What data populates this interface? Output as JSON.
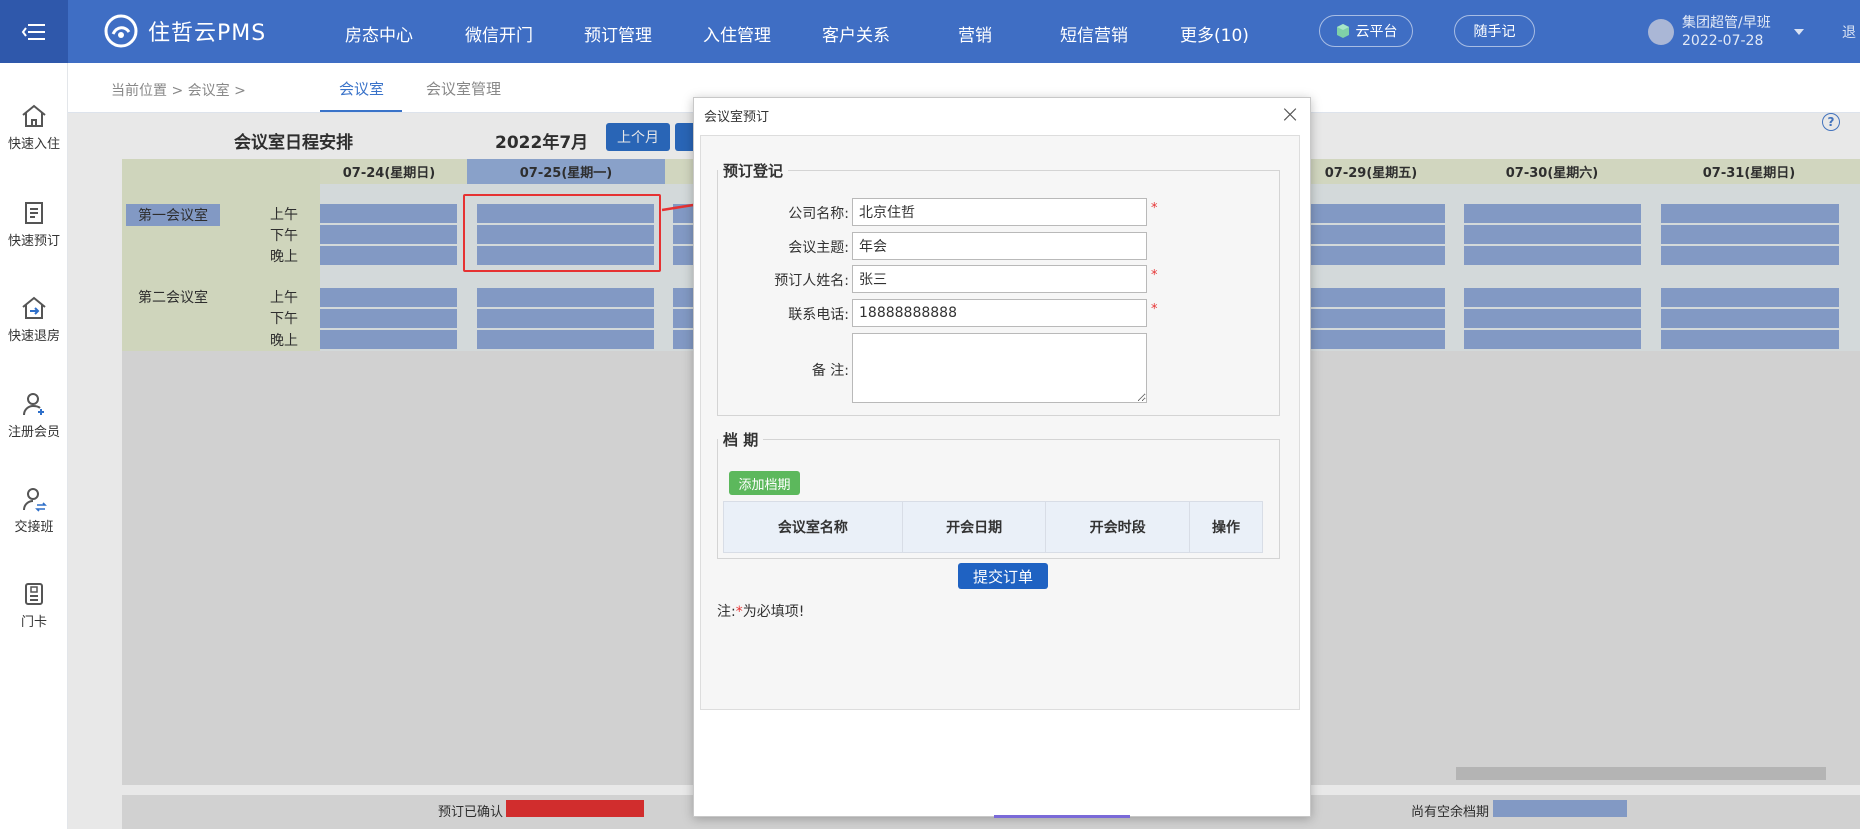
{
  "app": {
    "name": "住哲云PMS"
  },
  "nav": {
    "items": [
      "房态中心",
      "微信开门",
      "预订管理",
      "入住管理",
      "客户关系",
      "营销",
      "短信营销",
      "更多(10)"
    ]
  },
  "top_right": {
    "cloud": "云平台",
    "notes": "随手记",
    "user": "集团超管/早班",
    "date": "2022-07-28",
    "extra": "退"
  },
  "sidebar": {
    "items": [
      "快速入住",
      "快速预订",
      "快速退房",
      "注册会员",
      "交接班",
      "门卡"
    ]
  },
  "breadcrumb": "当前位置 > 会议室 >",
  "subtabs": [
    {
      "label": "会议室",
      "active": true
    },
    {
      "label": "会议室管理",
      "active": false
    }
  ],
  "schedule": {
    "title": "会议室日程安排",
    "month": "2022年7月",
    "prev_month": "上个月",
    "days": [
      "07-24(星期日)",
      "07-25(星期一)",
      "07-29(星期五)",
      "07-30(星期六)",
      "07-31(星期日)"
    ],
    "rooms": [
      {
        "name": "第一会议室",
        "slots": [
          "上午",
          "下午",
          "晚上"
        ]
      },
      {
        "name": "第二会议室",
        "slots": [
          "上午",
          "下午",
          "晚上"
        ]
      }
    ]
  },
  "legend": {
    "confirmed": "预订已确认",
    "available": "尚有空余档期"
  },
  "dialog": {
    "title": "会议室预订",
    "section1": "预订登记",
    "fields": {
      "company": {
        "label": "公司名称:",
        "value": "北京住哲",
        "required": true
      },
      "topic": {
        "label": "会议主题:",
        "value": "年会",
        "required": false
      },
      "booker": {
        "label": "预订人姓名:",
        "value": "张三",
        "required": true
      },
      "phone": {
        "label": "联系电话:",
        "value": "18888888888",
        "required": true
      },
      "remark": {
        "label": "备 注:",
        "value": ""
      }
    },
    "section2": "档 期",
    "add_schedule": "添加档期",
    "table_headers": [
      "会议室名称",
      "开会日期",
      "开会时段",
      "操作"
    ],
    "submit": "提交订单",
    "note_prefix": "注:",
    "note_star": "*",
    "note_suffix": "为必填项!"
  }
}
